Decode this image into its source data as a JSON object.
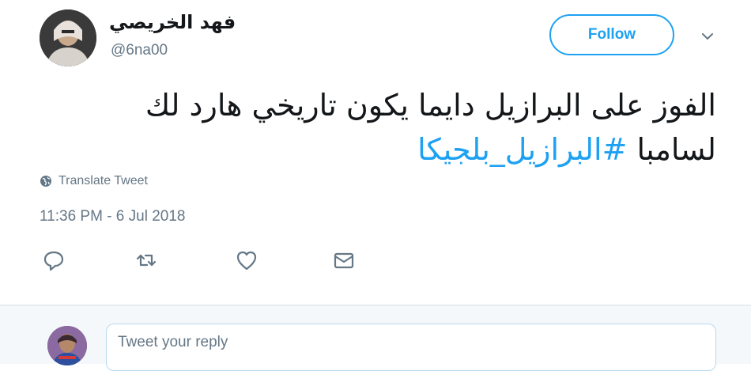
{
  "tweet": {
    "author": {
      "display_name": "فهد الخريصي",
      "handle": "@6na00",
      "avatar_icon": "user-avatar"
    },
    "follow_label": "Follow",
    "text_line1": "الفوز على البرازيل دايما يكون تاريخي هارد لك",
    "text_line2_plain": "لسامبا  ",
    "hashtag": "#البرازيل_بلجيكا",
    "translate_label": "Translate Tweet",
    "timestamp": "11:36 PM - 6 Jul 2018",
    "actions": [
      "reply-icon",
      "retweet-icon",
      "like-icon",
      "direct-message-icon"
    ]
  },
  "reply": {
    "placeholder": "Tweet your reply"
  },
  "colors": {
    "accent": "#1da1f2",
    "secondary_text": "#657786",
    "primary_text": "#14171a",
    "reply_background": "#f5f8fa"
  }
}
